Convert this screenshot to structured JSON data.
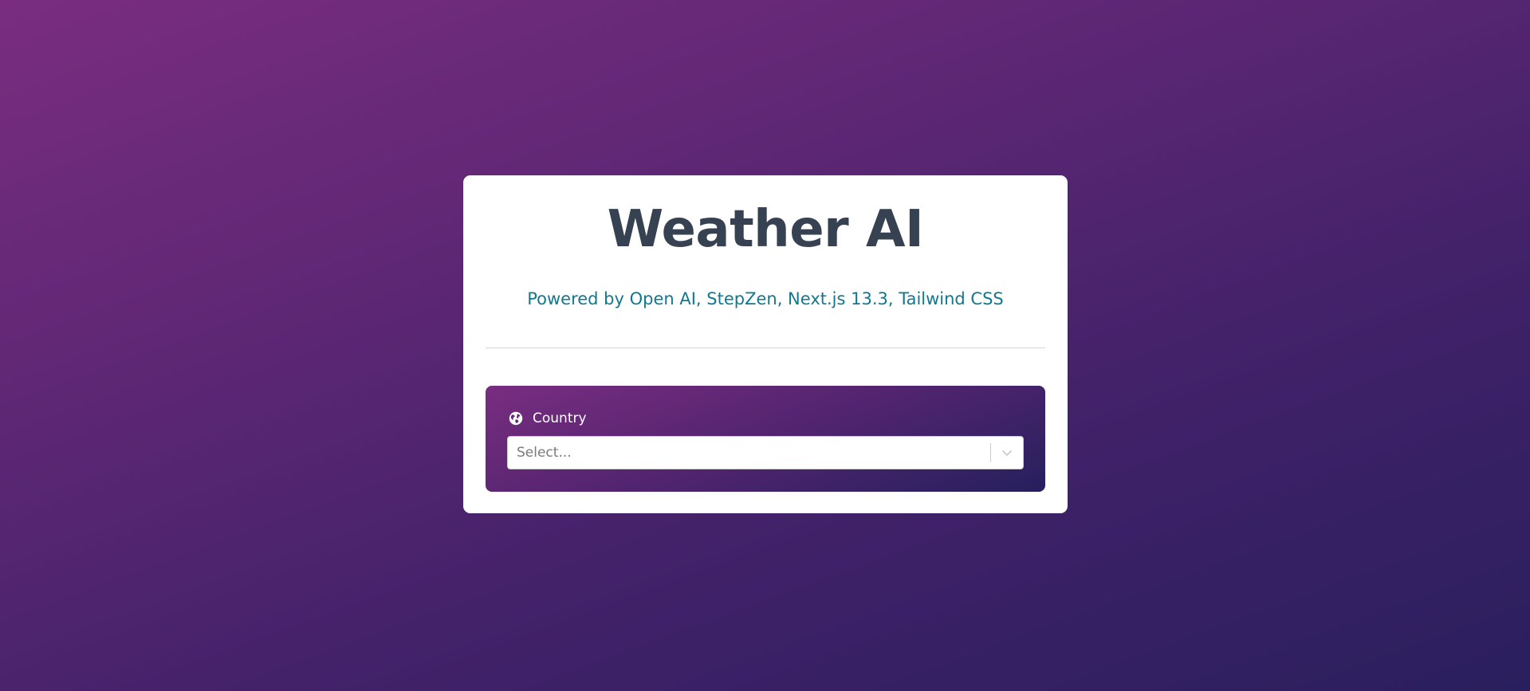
{
  "header": {
    "title": "Weather AI",
    "subtitle": "Powered by Open AI, StepZen, Next.js 13.3, Tailwind CSS"
  },
  "form": {
    "country_label": "Country",
    "country_icon": "globe-icon",
    "country_select": {
      "placeholder": "Select...",
      "value": "",
      "indicator_icon": "chevron-down-icon"
    }
  },
  "colors": {
    "title": "#364252",
    "subtitle": "#12788f",
    "background_start": "#7a2d80",
    "background_end": "#2a1f5e",
    "card": "#ffffff"
  }
}
